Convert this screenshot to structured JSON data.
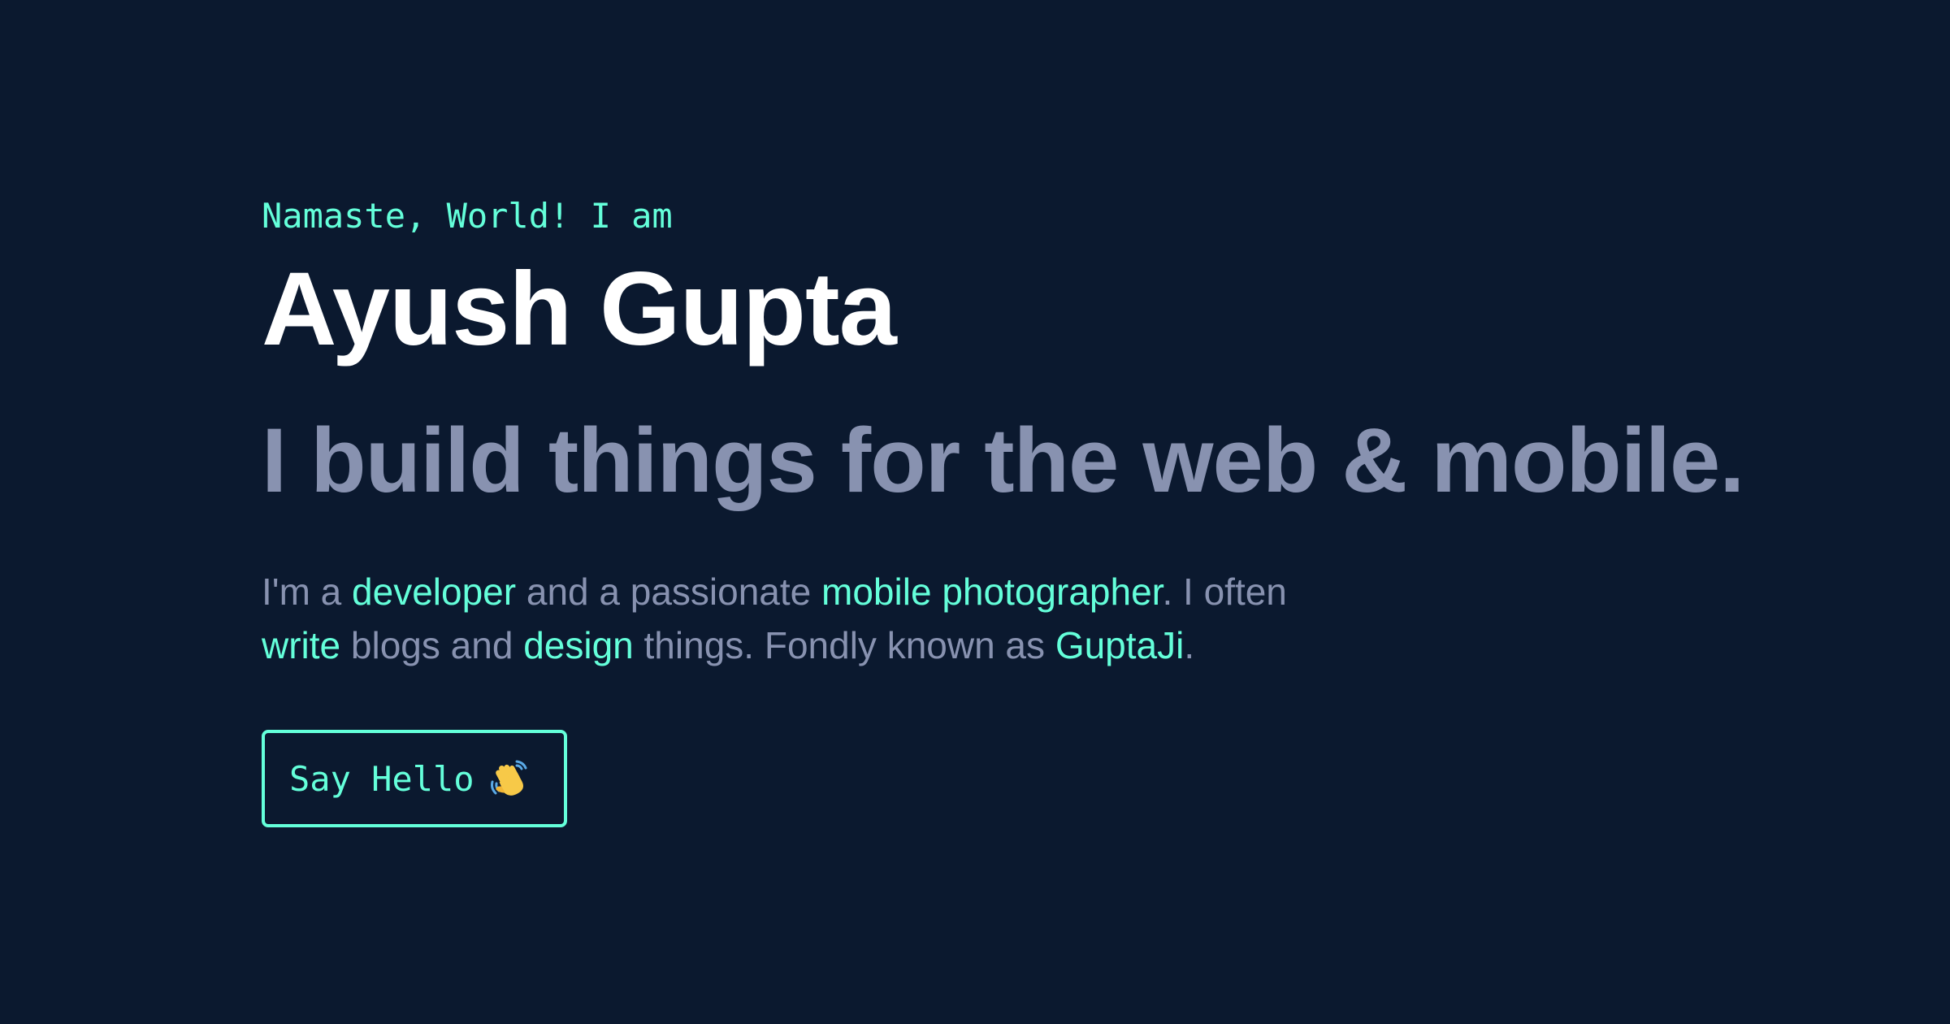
{
  "hero": {
    "greeting": "Namaste, World! I am",
    "name": "Ayush Gupta",
    "tagline": "I build things for the web & mobile.",
    "intro": {
      "t1": "I'm a ",
      "h1": "developer",
      "t2": " and a passionate ",
      "h2": "mobile photographer",
      "t3": ". I often ",
      "h3": "write",
      "t4": " blogs and ",
      "h4": "design",
      "t5": " things. Fondly known as ",
      "h5": "GuptaJi",
      "t6": "."
    },
    "cta": {
      "label": "Say Hello",
      "icon": "waving-hand-icon"
    }
  },
  "colors": {
    "background": "#0b192f",
    "accent": "#64ffda",
    "heading": "#ffffff",
    "muted": "#8892b0"
  }
}
